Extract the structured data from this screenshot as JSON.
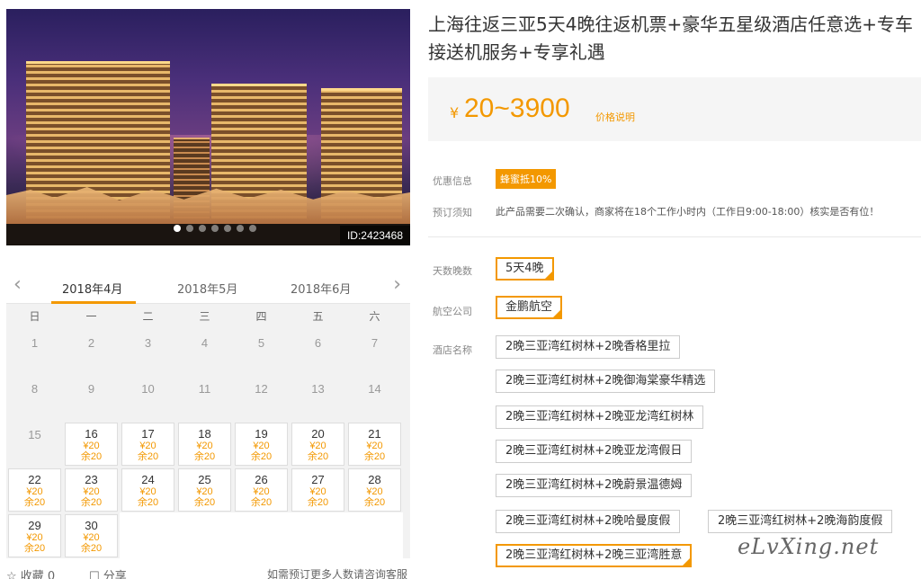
{
  "hero": {
    "id_label": "ID:2423468",
    "slide_count": 7,
    "active_slide": 0
  },
  "calendar": {
    "prev_arrow": "‹",
    "next_arrow": "›",
    "months": [
      "2018年4月",
      "2018年5月",
      "2018年6月"
    ],
    "weekdays": [
      "日",
      "一",
      "二",
      "三",
      "四",
      "五",
      "六"
    ],
    "days": [
      {
        "d": "1"
      },
      {
        "d": "2"
      },
      {
        "d": "3"
      },
      {
        "d": "4"
      },
      {
        "d": "5"
      },
      {
        "d": "6"
      },
      {
        "d": "7"
      },
      {
        "d": "8"
      },
      {
        "d": "9"
      },
      {
        "d": "10"
      },
      {
        "d": "11"
      },
      {
        "d": "12"
      },
      {
        "d": "13"
      },
      {
        "d": "14"
      },
      {
        "d": "15"
      },
      {
        "d": "16",
        "price": "¥20",
        "stock": "余20"
      },
      {
        "d": "17",
        "price": "¥20",
        "stock": "余20"
      },
      {
        "d": "18",
        "price": "¥20",
        "stock": "余20"
      },
      {
        "d": "19",
        "price": "¥20",
        "stock": "余20"
      },
      {
        "d": "20",
        "price": "¥20",
        "stock": "余20"
      },
      {
        "d": "21",
        "price": "¥20",
        "stock": "余20"
      },
      {
        "d": "22",
        "price": "¥20",
        "stock": "余20"
      },
      {
        "d": "23",
        "price": "¥20",
        "stock": "余20"
      },
      {
        "d": "24",
        "price": "¥20",
        "stock": "余20"
      },
      {
        "d": "25",
        "price": "¥20",
        "stock": "余20"
      },
      {
        "d": "26",
        "price": "¥20",
        "stock": "余20"
      },
      {
        "d": "27",
        "price": "¥20",
        "stock": "余20"
      },
      {
        "d": "28",
        "price": "¥20",
        "stock": "余20"
      },
      {
        "d": "29",
        "price": "¥20",
        "stock": "余20"
      },
      {
        "d": "30",
        "price": "¥20",
        "stock": "余20"
      }
    ],
    "footer": {
      "favorite": "☆ 收藏 0",
      "share": "☐ 分享",
      "consult": "如需预订更多人数请咨询客服"
    }
  },
  "product": {
    "title": "上海往返三亚5天4晚往返机票+豪华五星级酒店任意选+专车接送机服务+专享礼遇",
    "currency": "¥",
    "price_range": "20~3900",
    "price_note": "价格说明",
    "promo_label": "优惠信息",
    "promo_tag": "蜂蜜抵10%",
    "notice_label": "预订须知",
    "notice_text": "此产品需要二次确认，商家将在18个工作小时内（工作日9:00-18:00）核实是否有位！",
    "days_label": "天数晚数",
    "days_option": "5天4晚",
    "airline_label": "航空公司",
    "airline_option": "金鹏航空",
    "hotel_label": "酒店名称",
    "hotels": [
      "2晚三亚湾红树林+2晚香格里拉",
      "2晚三亚湾红树林+2晚御海棠豪华精选",
      "2晚三亚湾红树林+2晚亚龙湾红树林",
      "2晚三亚湾红树林+2晚亚龙湾假日",
      "2晚三亚湾红树林+2晚蔚景温德姆",
      "2晚三亚湾红树林+2晚哈曼度假",
      "2晚三亚湾红树林+2晚海韵度假",
      "2晚三亚湾红树林+2晚三亚湾胜意"
    ],
    "selected_hotel_index": 7
  },
  "watermark": "eLvXing.net",
  "colors": {
    "accent": "#f39800",
    "price_bg": "#f5f5f5"
  }
}
